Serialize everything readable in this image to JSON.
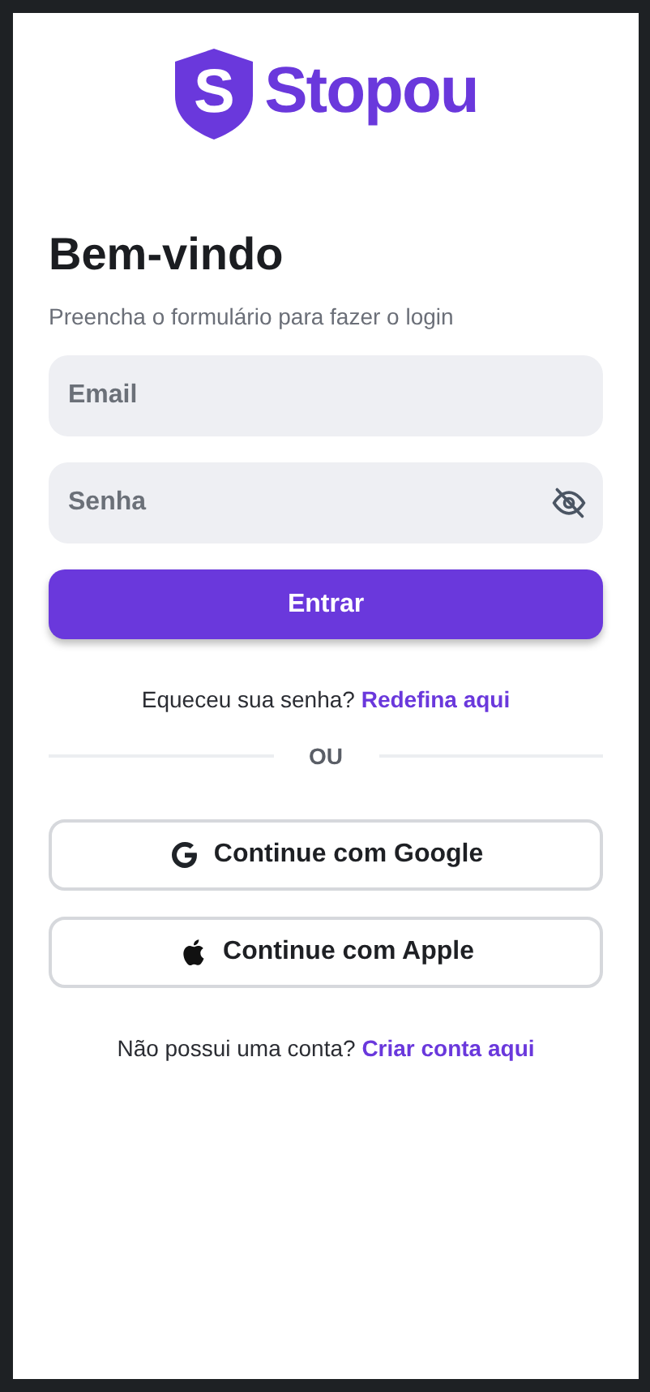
{
  "logo": {
    "mark": "S",
    "name": "Stopou"
  },
  "title": "Bem-vindo",
  "subtitle": "Preencha o formulário para fazer o login",
  "fields": [
    {
      "placeholder": "Email",
      "kind": "text"
    },
    {
      "placeholder": "Senha",
      "kind": "password"
    }
  ],
  "submit": "Entrar",
  "forgot": {
    "text": "Equeceu sua senha?",
    "link": "Redefina aqui"
  },
  "divider": "OU",
  "social": [
    {
      "kind": "google",
      "label": "Continue com Google"
    },
    {
      "kind": "apple",
      "label": "Continue com Apple"
    }
  ],
  "signup": {
    "text": "Não possui uma conta?",
    "link": "Criar conta aqui"
  }
}
